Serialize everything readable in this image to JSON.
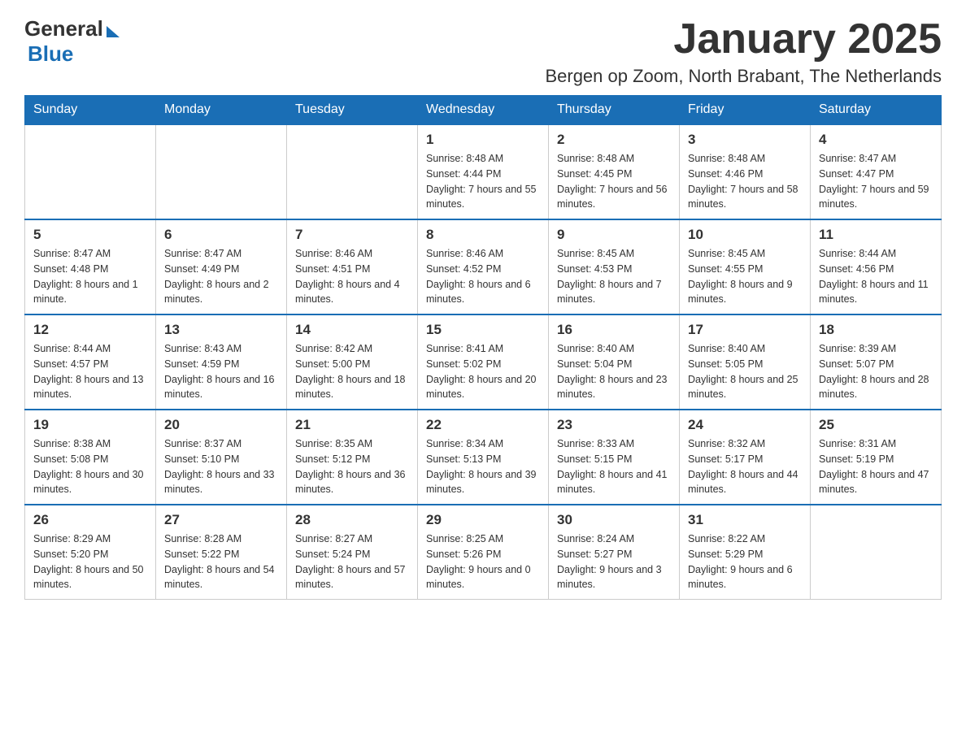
{
  "header": {
    "logo_general": "General",
    "logo_blue": "Blue",
    "month_title": "January 2025",
    "location": "Bergen op Zoom, North Brabant, The Netherlands"
  },
  "weekdays": [
    "Sunday",
    "Monday",
    "Tuesday",
    "Wednesday",
    "Thursday",
    "Friday",
    "Saturday"
  ],
  "weeks": [
    [
      {
        "day": "",
        "info": ""
      },
      {
        "day": "",
        "info": ""
      },
      {
        "day": "",
        "info": ""
      },
      {
        "day": "1",
        "info": "Sunrise: 8:48 AM\nSunset: 4:44 PM\nDaylight: 7 hours\nand 55 minutes."
      },
      {
        "day": "2",
        "info": "Sunrise: 8:48 AM\nSunset: 4:45 PM\nDaylight: 7 hours\nand 56 minutes."
      },
      {
        "day": "3",
        "info": "Sunrise: 8:48 AM\nSunset: 4:46 PM\nDaylight: 7 hours\nand 58 minutes."
      },
      {
        "day": "4",
        "info": "Sunrise: 8:47 AM\nSunset: 4:47 PM\nDaylight: 7 hours\nand 59 minutes."
      }
    ],
    [
      {
        "day": "5",
        "info": "Sunrise: 8:47 AM\nSunset: 4:48 PM\nDaylight: 8 hours\nand 1 minute."
      },
      {
        "day": "6",
        "info": "Sunrise: 8:47 AM\nSunset: 4:49 PM\nDaylight: 8 hours\nand 2 minutes."
      },
      {
        "day": "7",
        "info": "Sunrise: 8:46 AM\nSunset: 4:51 PM\nDaylight: 8 hours\nand 4 minutes."
      },
      {
        "day": "8",
        "info": "Sunrise: 8:46 AM\nSunset: 4:52 PM\nDaylight: 8 hours\nand 6 minutes."
      },
      {
        "day": "9",
        "info": "Sunrise: 8:45 AM\nSunset: 4:53 PM\nDaylight: 8 hours\nand 7 minutes."
      },
      {
        "day": "10",
        "info": "Sunrise: 8:45 AM\nSunset: 4:55 PM\nDaylight: 8 hours\nand 9 minutes."
      },
      {
        "day": "11",
        "info": "Sunrise: 8:44 AM\nSunset: 4:56 PM\nDaylight: 8 hours\nand 11 minutes."
      }
    ],
    [
      {
        "day": "12",
        "info": "Sunrise: 8:44 AM\nSunset: 4:57 PM\nDaylight: 8 hours\nand 13 minutes."
      },
      {
        "day": "13",
        "info": "Sunrise: 8:43 AM\nSunset: 4:59 PM\nDaylight: 8 hours\nand 16 minutes."
      },
      {
        "day": "14",
        "info": "Sunrise: 8:42 AM\nSunset: 5:00 PM\nDaylight: 8 hours\nand 18 minutes."
      },
      {
        "day": "15",
        "info": "Sunrise: 8:41 AM\nSunset: 5:02 PM\nDaylight: 8 hours\nand 20 minutes."
      },
      {
        "day": "16",
        "info": "Sunrise: 8:40 AM\nSunset: 5:04 PM\nDaylight: 8 hours\nand 23 minutes."
      },
      {
        "day": "17",
        "info": "Sunrise: 8:40 AM\nSunset: 5:05 PM\nDaylight: 8 hours\nand 25 minutes."
      },
      {
        "day": "18",
        "info": "Sunrise: 8:39 AM\nSunset: 5:07 PM\nDaylight: 8 hours\nand 28 minutes."
      }
    ],
    [
      {
        "day": "19",
        "info": "Sunrise: 8:38 AM\nSunset: 5:08 PM\nDaylight: 8 hours\nand 30 minutes."
      },
      {
        "day": "20",
        "info": "Sunrise: 8:37 AM\nSunset: 5:10 PM\nDaylight: 8 hours\nand 33 minutes."
      },
      {
        "day": "21",
        "info": "Sunrise: 8:35 AM\nSunset: 5:12 PM\nDaylight: 8 hours\nand 36 minutes."
      },
      {
        "day": "22",
        "info": "Sunrise: 8:34 AM\nSunset: 5:13 PM\nDaylight: 8 hours\nand 39 minutes."
      },
      {
        "day": "23",
        "info": "Sunrise: 8:33 AM\nSunset: 5:15 PM\nDaylight: 8 hours\nand 41 minutes."
      },
      {
        "day": "24",
        "info": "Sunrise: 8:32 AM\nSunset: 5:17 PM\nDaylight: 8 hours\nand 44 minutes."
      },
      {
        "day": "25",
        "info": "Sunrise: 8:31 AM\nSunset: 5:19 PM\nDaylight: 8 hours\nand 47 minutes."
      }
    ],
    [
      {
        "day": "26",
        "info": "Sunrise: 8:29 AM\nSunset: 5:20 PM\nDaylight: 8 hours\nand 50 minutes."
      },
      {
        "day": "27",
        "info": "Sunrise: 8:28 AM\nSunset: 5:22 PM\nDaylight: 8 hours\nand 54 minutes."
      },
      {
        "day": "28",
        "info": "Sunrise: 8:27 AM\nSunset: 5:24 PM\nDaylight: 8 hours\nand 57 minutes."
      },
      {
        "day": "29",
        "info": "Sunrise: 8:25 AM\nSunset: 5:26 PM\nDaylight: 9 hours\nand 0 minutes."
      },
      {
        "day": "30",
        "info": "Sunrise: 8:24 AM\nSunset: 5:27 PM\nDaylight: 9 hours\nand 3 minutes."
      },
      {
        "day": "31",
        "info": "Sunrise: 8:22 AM\nSunset: 5:29 PM\nDaylight: 9 hours\nand 6 minutes."
      },
      {
        "day": "",
        "info": ""
      }
    ]
  ]
}
